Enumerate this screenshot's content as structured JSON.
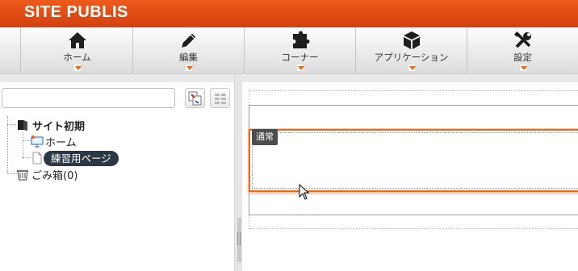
{
  "app": {
    "brand": "SITE PUBLIS"
  },
  "nav": [
    {
      "label": "ホーム",
      "icon": "home-icon"
    },
    {
      "label": "編集",
      "icon": "pencil-icon"
    },
    {
      "label": "コーナー",
      "icon": "puzzle-icon"
    },
    {
      "label": "アプリケーション",
      "icon": "cube-icon"
    },
    {
      "label": "設定",
      "icon": "tools-icon"
    }
  ],
  "sidebar": {
    "search": {
      "value": "",
      "placeholder": ""
    },
    "tree": {
      "root": "サイト初期",
      "home": "ホーム",
      "selected_page": "練習用ページ",
      "trash": "ごみ箱(0)"
    }
  },
  "editor": {
    "block_tag": "通常"
  },
  "colors": {
    "brand": "#e24e17",
    "accent_border": "#e96a12",
    "selected_bg": "#2c3744"
  }
}
